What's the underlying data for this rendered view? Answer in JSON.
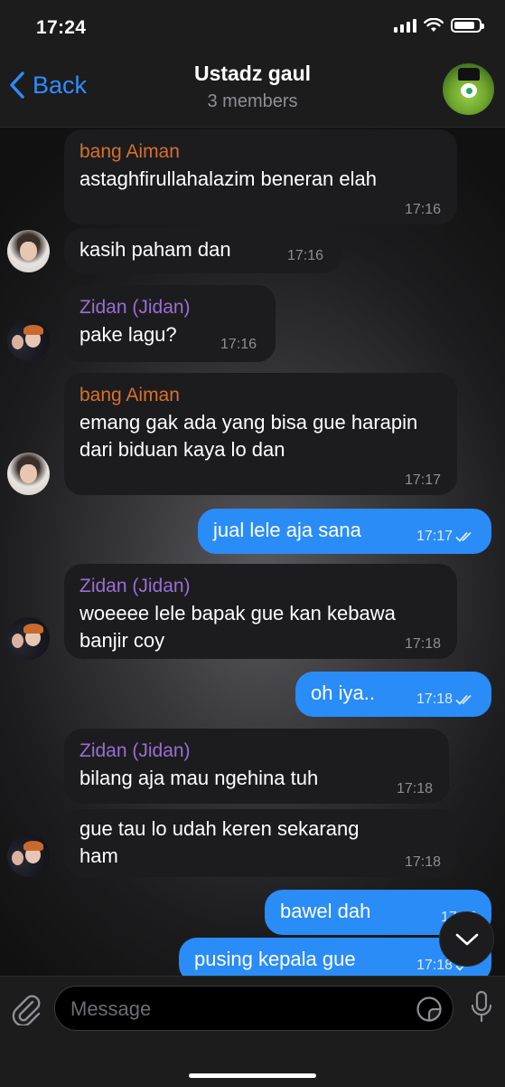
{
  "status_bar": {
    "time": "17:24"
  },
  "header": {
    "back_label": "Back",
    "title": "Ustadz gaul",
    "subtitle": "3 members"
  },
  "messages": [
    {
      "direction": "in",
      "sender": "bang Aiman",
      "text": "astaghfirullahalazim beneran elah",
      "time": "17:16"
    },
    {
      "direction": "in",
      "sender": "",
      "text": "kasih paham dan",
      "time": "17:16"
    },
    {
      "direction": "in",
      "sender": "Zidan (Jidan)",
      "text": "pake lagu?",
      "time": "17:16"
    },
    {
      "direction": "in",
      "sender": "bang Aiman",
      "text": "emang gak ada yang bisa gue harapin dari biduan kaya lo dan",
      "time": "17:17"
    },
    {
      "direction": "out",
      "sender": "",
      "text": "jual lele aja sana",
      "time": "17:17"
    },
    {
      "direction": "in",
      "sender": "Zidan (Jidan)",
      "text": "woeeee lele bapak gue kan kebawa banjir coy",
      "time": "17:18"
    },
    {
      "direction": "out",
      "sender": "",
      "text": "oh iya..",
      "time": "17:18"
    },
    {
      "direction": "in",
      "sender": "Zidan (Jidan)",
      "text": "bilang aja mau ngehina tuh",
      "time": "17:18"
    },
    {
      "direction": "in",
      "sender": "",
      "text": "gue tau lo udah keren sekarang ham",
      "time": "17:18"
    },
    {
      "direction": "out",
      "sender": "",
      "text": "bawel dah",
      "time": "17:18"
    },
    {
      "direction": "out",
      "sender": "",
      "text": "pusing kepala gue",
      "time": "17:18"
    }
  ],
  "input": {
    "placeholder": "Message"
  },
  "colors": {
    "accent": "#2f8cff",
    "outgoing_bubble": "#2a8cf6",
    "incoming_bubble": "#1c1c1e",
    "sender_aiman": "#d8702e",
    "sender_zidan": "#9a6ed3"
  },
  "icons": [
    "signal-icon",
    "wifi-icon",
    "battery-icon",
    "back-chevron-icon",
    "read-checkmarks-icon",
    "chevron-down-icon",
    "attach-icon",
    "sticker-icon",
    "mic-icon"
  ]
}
